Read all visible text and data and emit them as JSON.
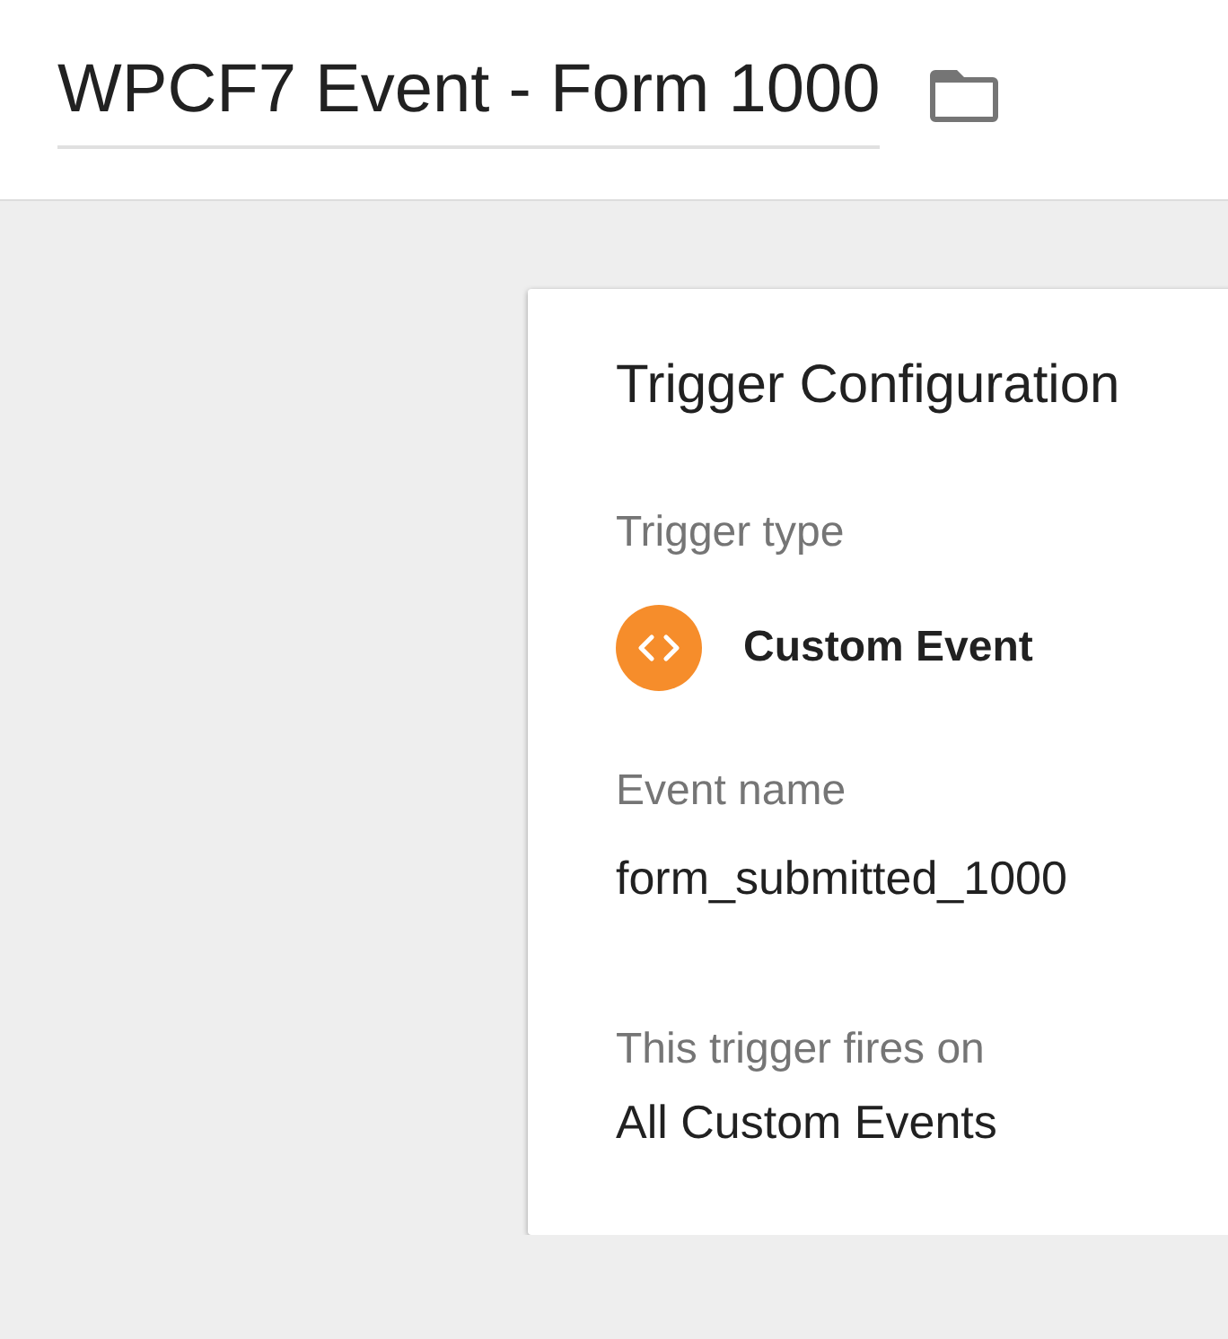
{
  "header": {
    "title": "WPCF7 Event - Form 1000"
  },
  "card": {
    "title": "Trigger Configuration",
    "sections": [
      {
        "kind": "type",
        "label": "Trigger type",
        "value": "Custom Event"
      },
      {
        "kind": "field",
        "label": "Event name",
        "value": "form_submitted_1000"
      },
      {
        "kind": "summary",
        "label": "This trigger fires on",
        "value": "All Custom Events"
      }
    ]
  }
}
